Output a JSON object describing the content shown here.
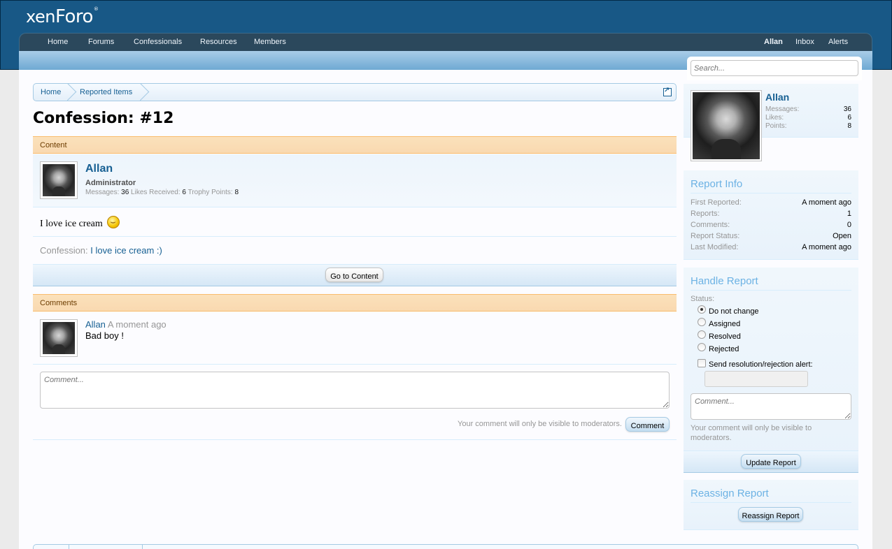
{
  "logo": {
    "part1": "xen",
    "part2": "Foro",
    "mark": "®"
  },
  "nav": {
    "home": "Home",
    "forums": "Forums",
    "confessionals": "Confessionals",
    "resources": "Resources",
    "members": "Members",
    "user": "Allan",
    "inbox": "Inbox",
    "alerts": "Alerts"
  },
  "search": {
    "placeholder": "Search..."
  },
  "breadcrumb": {
    "items": [
      "Home",
      "Reported Items"
    ]
  },
  "page": {
    "title": "Confession: #12"
  },
  "content_section": {
    "heading": "Content",
    "author": "Allan",
    "user_title": "Administrator",
    "stats": {
      "messages_label": "Messages:",
      "messages": "36",
      "likes_label": "Likes Received:",
      "likes": "6",
      "points_label": "Trophy Points:",
      "points": "8"
    },
    "body": "I love ice cream",
    "confession_label": "Confession:",
    "confession_link": "I love ice cream :)",
    "goto_button": "Go to Content"
  },
  "comments_section": {
    "heading": "Comments",
    "comment": {
      "author": "Allan",
      "time": "A moment ago",
      "text": "Bad boy !"
    },
    "input_placeholder": "Comment...",
    "note": "Your comment will only be visible to moderators.",
    "submit": "Comment"
  },
  "visitor": {
    "name": "Allan",
    "messages_label": "Messages:",
    "messages": "36",
    "likes_label": "Likes:",
    "likes": "6",
    "points_label": "Points:",
    "points": "8"
  },
  "report_info": {
    "heading": "Report Info",
    "rows": [
      {
        "label": "First Reported:",
        "value": "A moment ago"
      },
      {
        "label": "Reports:",
        "value": "1"
      },
      {
        "label": "Comments:",
        "value": "0"
      },
      {
        "label": "Report Status:",
        "value": "Open"
      },
      {
        "label": "Last Modified:",
        "value": "A moment ago"
      }
    ]
  },
  "handle_report": {
    "heading": "Handle Report",
    "status_label": "Status:",
    "options": [
      "Do not change",
      "Assigned",
      "Resolved",
      "Rejected"
    ],
    "selected": "Do not change",
    "alert_label": "Send resolution/rejection alert:",
    "comment_placeholder": "Comment...",
    "note": "Your comment will only be visible to moderators.",
    "submit": "Update Report"
  },
  "reassign": {
    "heading": "Reassign Report",
    "button": "Reassign Report"
  },
  "colors": {
    "header": "#185886",
    "nav": "#2b485c",
    "accent": "#176093",
    "section_head": "#fbe1bb",
    "sidebar_heading": "#6cb2e4"
  }
}
